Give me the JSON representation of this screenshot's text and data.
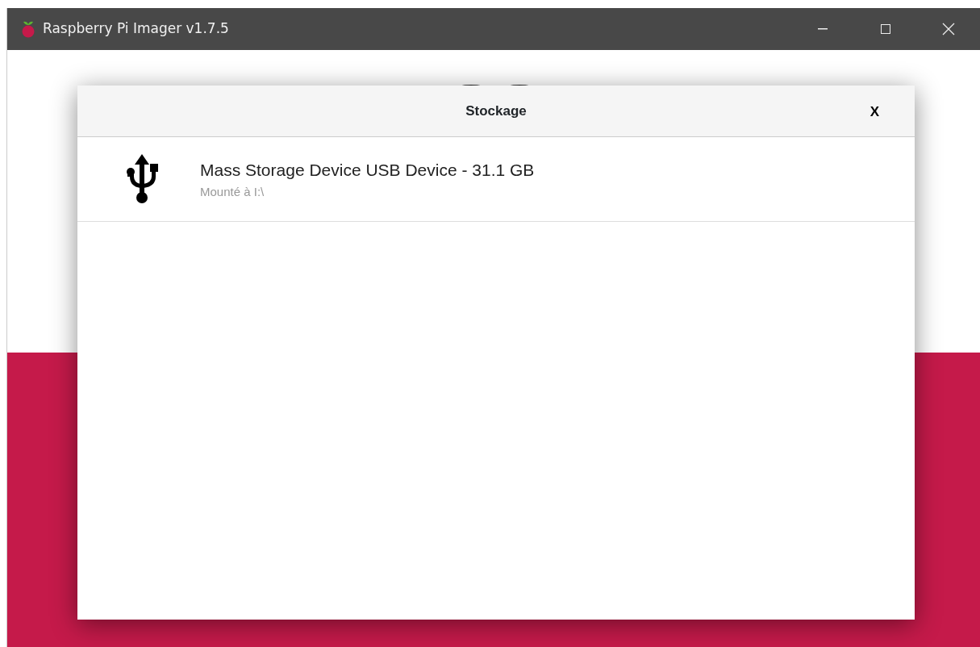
{
  "window": {
    "title": "Raspberry Pi Imager v1.7.5"
  },
  "dialog": {
    "title": "Stockage",
    "close": "X",
    "devices": [
      {
        "name": "Mass Storage Device USB Device - 31.1 GB",
        "detail": "Mounté à I:\\"
      }
    ]
  }
}
